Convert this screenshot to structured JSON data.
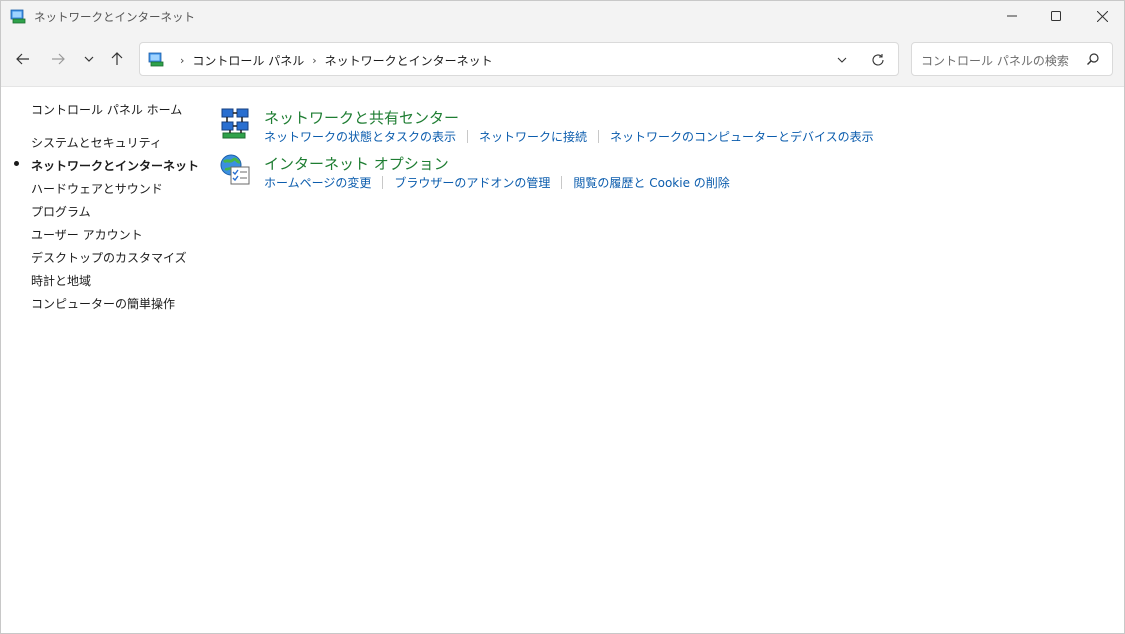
{
  "window": {
    "title": "ネットワークとインターネット"
  },
  "nav": {
    "back_icon": "arrow-left-icon",
    "forward_icon": "arrow-right-icon",
    "recent_icon": "chevron-down-icon",
    "up_icon": "arrow-up-icon"
  },
  "address": {
    "breadcrumbs": [
      "コントロール パネル",
      "ネットワークとインターネット"
    ]
  },
  "search": {
    "placeholder": "コントロール パネルの検索"
  },
  "sidebar": {
    "home": "コントロール パネル ホーム",
    "items": [
      "システムとセキュリティ",
      "ネットワークとインターネット",
      "ハードウェアとサウンド",
      "プログラム",
      "ユーザー アカウント",
      "デスクトップのカスタマイズ",
      "時計と地域",
      "コンピューターの簡単操作"
    ],
    "active_index": 1
  },
  "categories": [
    {
      "title": "ネットワークと共有センター",
      "icon": "network-center-icon",
      "links": [
        "ネットワークの状態とタスクの表示",
        "ネットワークに接続",
        "ネットワークのコンピューターとデバイスの表示"
      ]
    },
    {
      "title": "インターネット オプション",
      "icon": "internet-options-icon",
      "links": [
        "ホームページの変更",
        "ブラウザーのアドオンの管理",
        "閲覧の履歴と Cookie の削除"
      ]
    }
  ],
  "colors": {
    "category_title": "#1e7d32",
    "link": "#0b5cad",
    "chrome": "#f3f3f3"
  }
}
